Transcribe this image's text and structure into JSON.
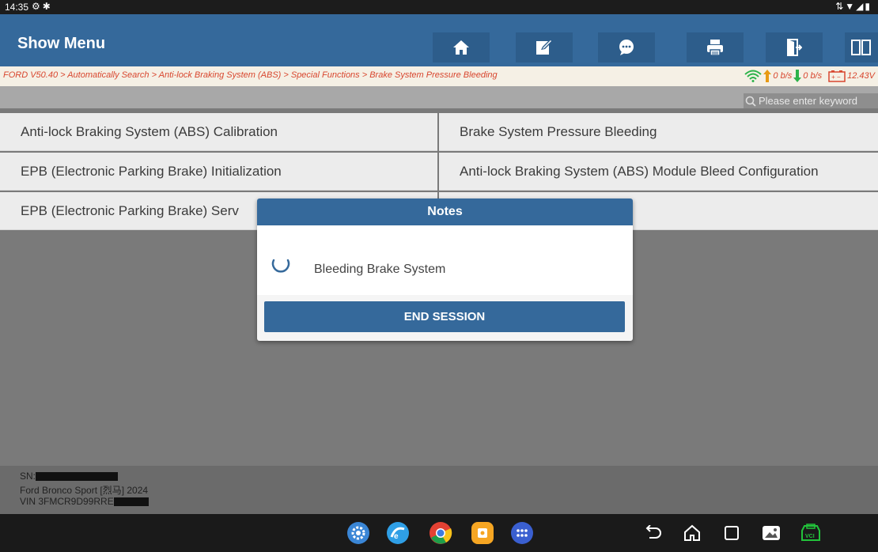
{
  "status_bar": {
    "time": "14:35"
  },
  "header": {
    "title": "Show Menu",
    "toolbar": [
      "home-icon",
      "edit-icon",
      "chat-icon",
      "print-icon",
      "exit-icon",
      "split-view-icon"
    ]
  },
  "breadcrumb": {
    "path": "FORD V50.40 > Automatically Search > Anti-lock Braking System (ABS) > Special Functions > Brake System Pressure Bleeding",
    "upload": "0 b/s",
    "download": "0 b/s",
    "voltage": "12.43V"
  },
  "search": {
    "placeholder": "Please enter keyword"
  },
  "menu": {
    "items": [
      "Anti-lock Braking System (ABS) Calibration",
      "Brake System Pressure Bleeding",
      "EPB (Electronic Parking Brake) Initialization",
      "Anti-lock Braking System (ABS) Module Bleed Configuration",
      "EPB (Electronic Parking Brake) Serv"
    ]
  },
  "vehicle_info": {
    "sn_label": "SN:",
    "model": "Ford Bronco Sport [烈马] 2024",
    "vin_prefix": "VIN 3FMCR9D99RRE"
  },
  "modal": {
    "title": "Notes",
    "message": "Bleeding Brake System",
    "button": "END SESSION"
  },
  "colors": {
    "header_blue": "#35699b",
    "breadcrumb_red": "#d8462e"
  }
}
